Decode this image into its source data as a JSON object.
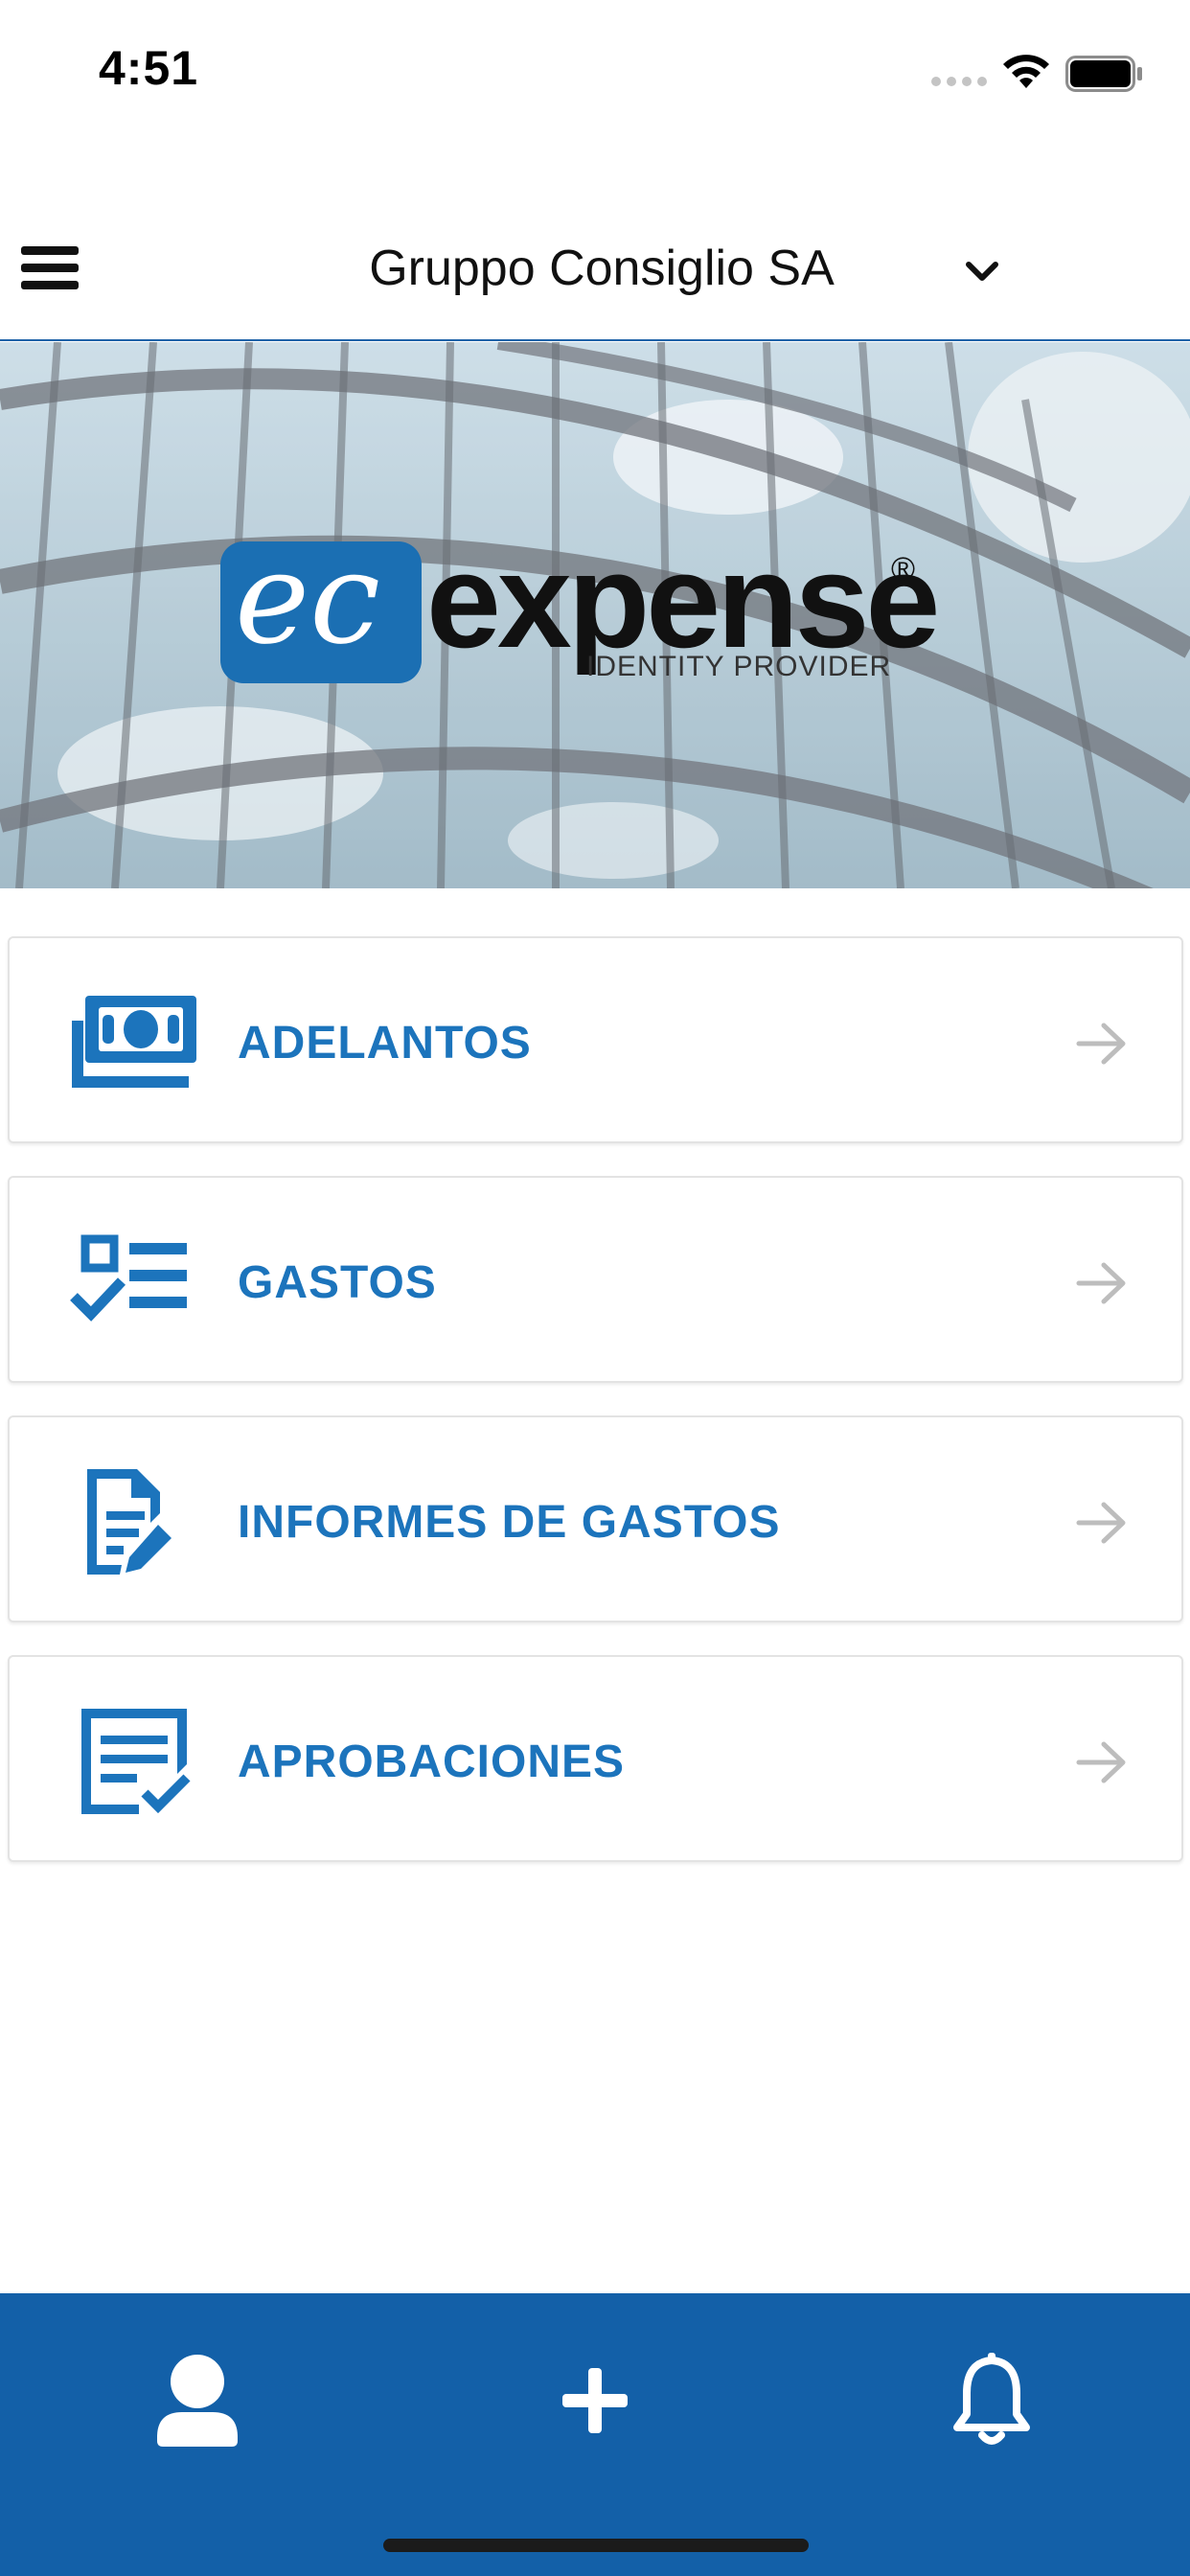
{
  "status_bar": {
    "time": "4:51"
  },
  "header": {
    "company_name": "Gruppo Consiglio SA"
  },
  "hero": {
    "logo_mark": "ec",
    "logo_wordmark": "expense",
    "logo_registered": "®",
    "logo_tagline": "IDENTITY PROVIDER"
  },
  "menu": {
    "items": [
      {
        "label": "ADELANTOS",
        "icon": "money-bills-icon"
      },
      {
        "label": "GASTOS",
        "icon": "checklist-icon"
      },
      {
        "label": "INFORMES DE GASTOS",
        "icon": "document-edit-icon"
      },
      {
        "label": "APROBACIONES",
        "icon": "approval-document-icon"
      }
    ]
  },
  "bottom_nav": {
    "tabs": [
      {
        "icon": "user-icon"
      },
      {
        "icon": "plus-icon"
      },
      {
        "icon": "bell-icon"
      }
    ]
  },
  "colors": {
    "accent": "#1c74bc",
    "bottom_bar": "#1360a8",
    "arrow": "#bdbdbd"
  }
}
